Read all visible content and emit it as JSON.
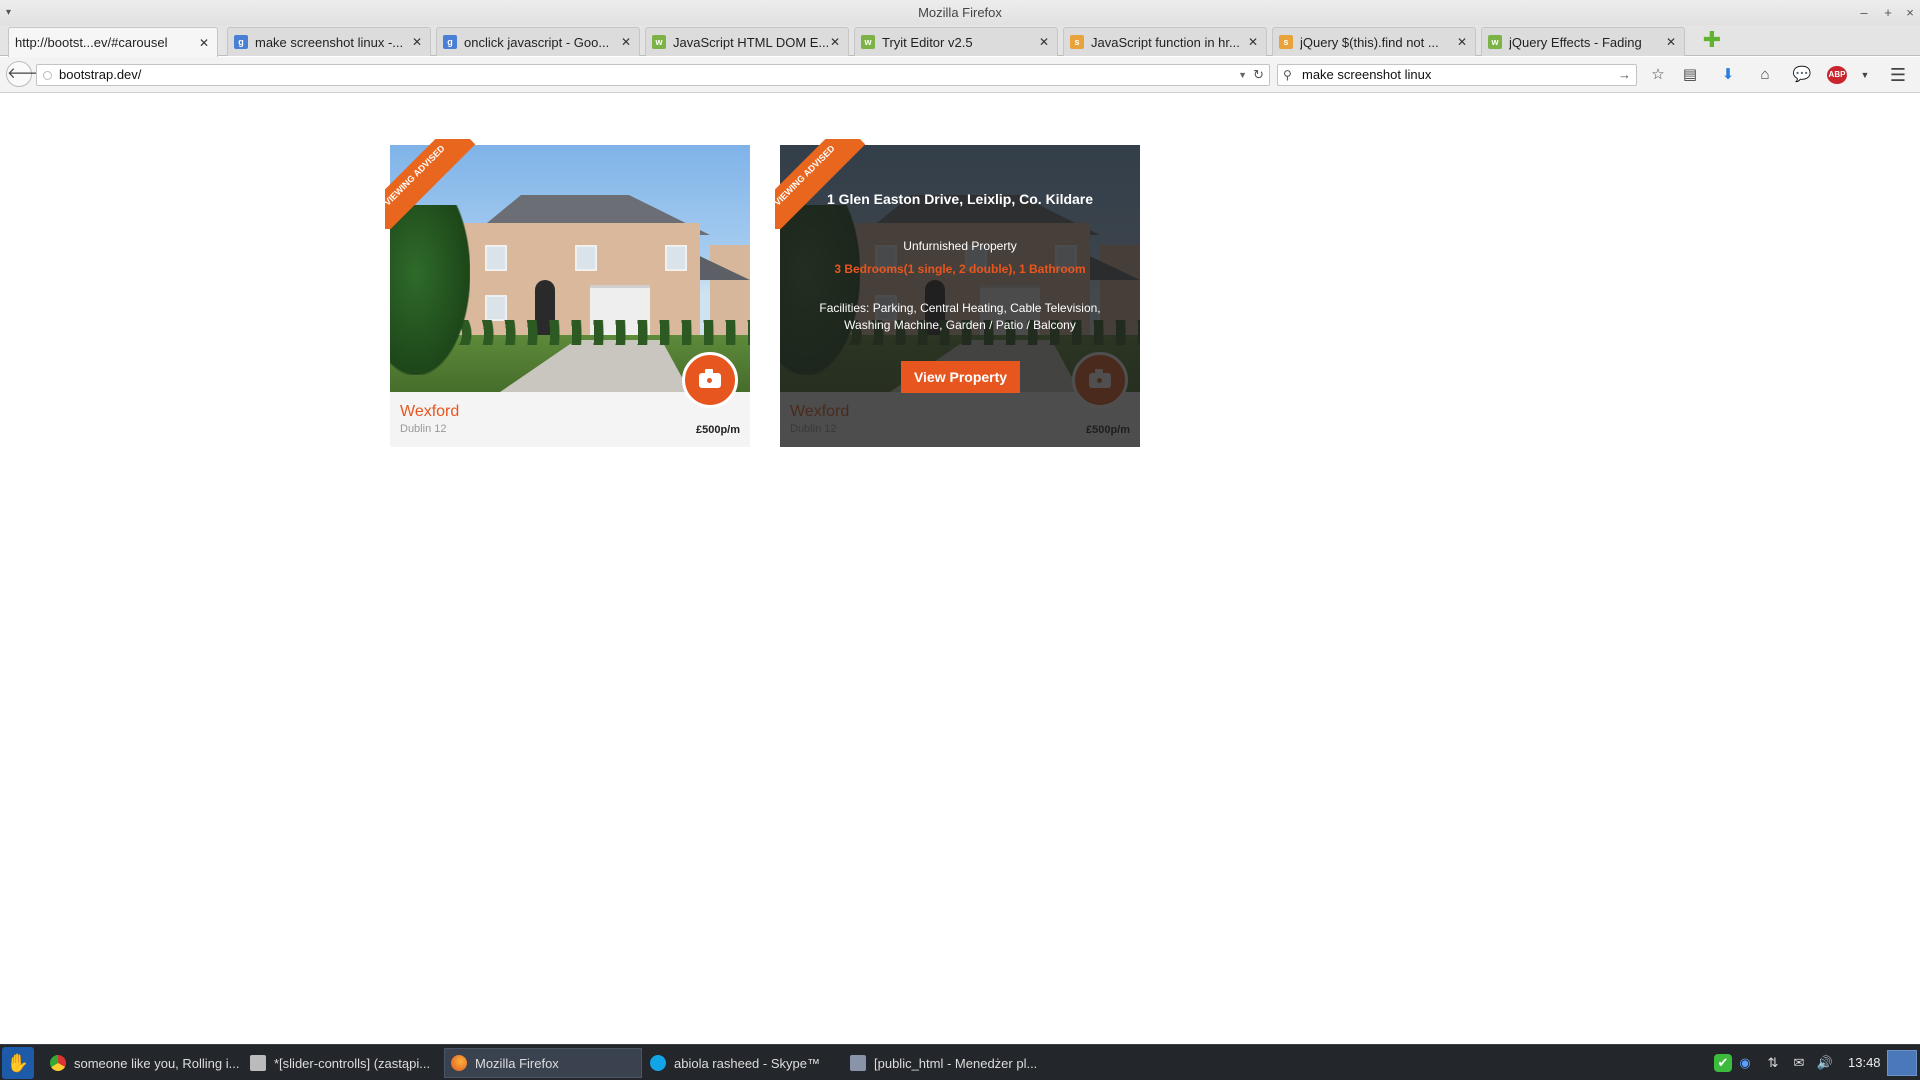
{
  "window": {
    "title": "Mozilla Firefox"
  },
  "tabs": [
    {
      "label": "http://bootst...ev/#carousel",
      "icon": "blank-page-icon",
      "active": true
    },
    {
      "label": "make screenshot linux -...",
      "icon": "google-icon"
    },
    {
      "label": "onclick javascript - Goo...",
      "icon": "google-icon"
    },
    {
      "label": "JavaScript HTML DOM E...",
      "icon": "w3schools-icon"
    },
    {
      "label": "Tryit Editor v2.5",
      "icon": "w3schools-icon"
    },
    {
      "label": "JavaScript function in hr...",
      "icon": "stackoverflow-icon"
    },
    {
      "label": "jQuery $(this).find not ...",
      "icon": "stackoverflow-icon"
    },
    {
      "label": "jQuery Effects - Fading",
      "icon": "w3schools-icon"
    }
  ],
  "navbar": {
    "url": "bootstrap.dev/",
    "search": "make screenshot linux"
  },
  "listing": {
    "ribbon": "Viewing Advised",
    "town": "Wexford",
    "area": "Dublin 12",
    "price": "£500p/m",
    "address": "1 Glen Easton Drive, Leixlip, Co. Kildare",
    "furnishing": "Unfurnished Property",
    "bedrooms": "3 Bedrooms(1 single, 2 double), 1 Bathroom",
    "facilities": "Facilities: Parking, Central Heating, Cable Television, Washing Machine, Garden / Patio / Balcony",
    "view_button": "View Property"
  },
  "taskbar": {
    "tasks": [
      {
        "label": "someone like you, Rolling i...",
        "icon": "chrome-icon"
      },
      {
        "label": "*[slider-controlls] (zastąpi...",
        "icon": "editor-icon"
      },
      {
        "label": "Mozilla Firefox",
        "icon": "firefox-icon",
        "active": true
      },
      {
        "label": "abiola rasheed - Skype™",
        "icon": "skype-icon"
      },
      {
        "label": "[public_html - Menedżer pl...",
        "icon": "folder-icon"
      }
    ],
    "clock": "13:48"
  },
  "colors": {
    "accent": "#e8561f",
    "ribbon": "#e8661e"
  }
}
